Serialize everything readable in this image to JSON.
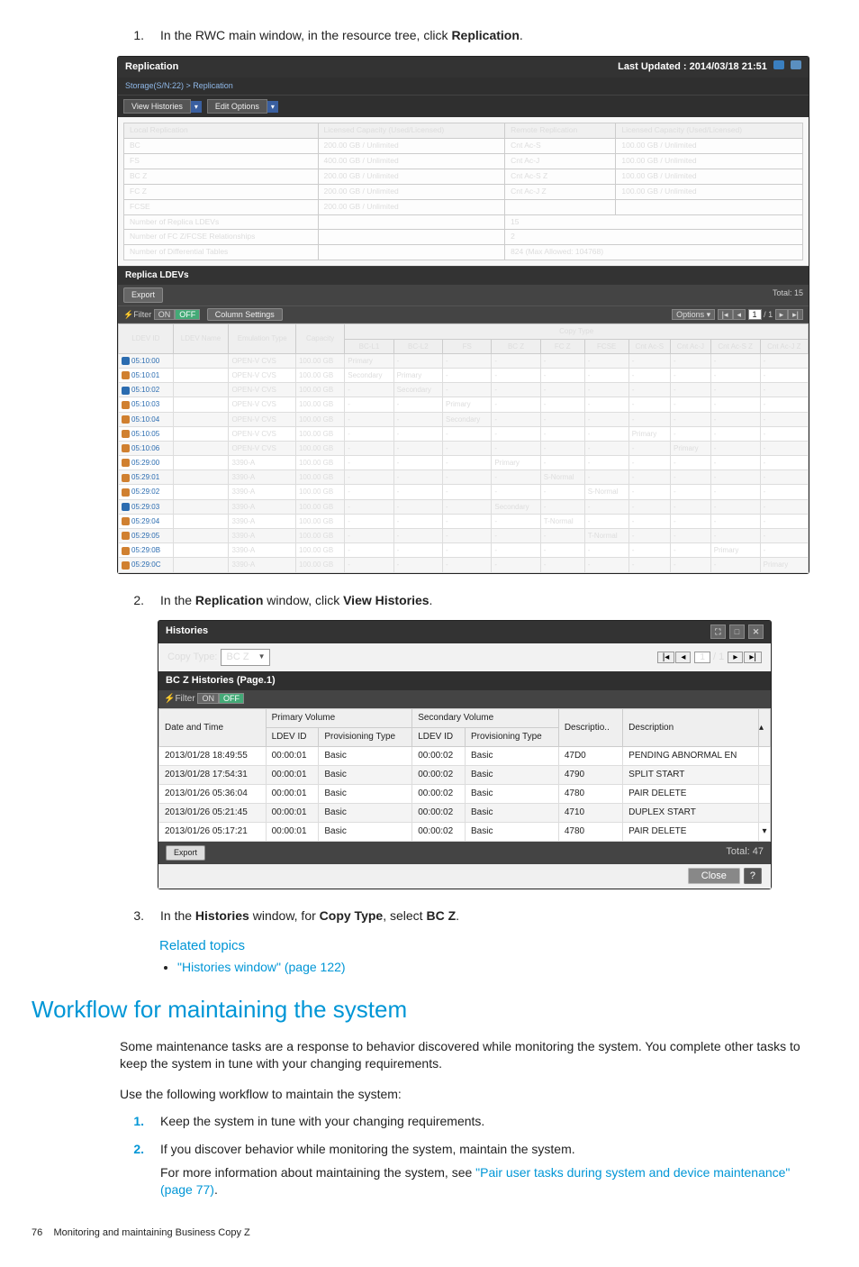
{
  "step1": {
    "num": "1.",
    "pre": "In the RWC main window, in the resource tree, click ",
    "bold": "Replication",
    "post": "."
  },
  "repl_panel": {
    "title": "Replication",
    "last_updated": "Last Updated : 2014/03/18 21:51",
    "breadcrumb": "Storage(S/N:22) > Replication",
    "dd1": "View Histories",
    "dd2": "Edit Options",
    "local_rep_hdr": "Local Replication",
    "lic_cap_hdr": "Licensed Capacity (Used/Licensed)",
    "remote_rep_hdr": "Remote Replication",
    "lic_cap_hdr2": "Licensed Capacity (Used/Licensed)",
    "local_rows": [
      {
        "n": "BC",
        "v": "200.00 GB / Unlimited"
      },
      {
        "n": "FS",
        "v": "400.00 GB / Unlimited"
      },
      {
        "n": "BC Z",
        "v": "200.00 GB / Unlimited"
      },
      {
        "n": "FC Z",
        "v": "200.00 GB / Unlimited"
      },
      {
        "n": "FCSE",
        "v": "200.00 GB / Unlimited"
      }
    ],
    "remote_rows": [
      {
        "n": "Cnt Ac-S",
        "v": "100.00 GB / Unlimited"
      },
      {
        "n": "Cnt Ac-J",
        "v": "100.00 GB / Unlimited"
      },
      {
        "n": "Cnt Ac-S Z",
        "v": "100.00 GB / Unlimited"
      },
      {
        "n": "Cnt Ac-J Z",
        "v": "100.00 GB / Unlimited"
      }
    ],
    "num_replica": {
      "l": "Number of Replica LDEVs",
      "v": "15"
    },
    "num_fcz": {
      "l": "Number of FC Z/FCSE Relationships",
      "v": "2"
    },
    "num_diff": {
      "l": "Number of Differential Tables",
      "v": "824 (Max Allowed: 104768)"
    },
    "replica_tab": "Replica LDEVs",
    "export": "Export",
    "total": "Total: 15",
    "filter": "⚡Filter",
    "on": "ON",
    "off": "OFF",
    "colset": "Column Settings",
    "options_lbl": "Options ▾",
    "pg": "1",
    "pgof": "/ 1",
    "copy_type_grp": "Copy Type",
    "cols": [
      "LDEV ID",
      "LDEV Name",
      "Emulation Type",
      "Capacity",
      "BC-L1",
      "BC-L2",
      "FS",
      "BC Z",
      "FC Z",
      "FCSE",
      "Cnt Ac-S",
      "Cnt Ac-J",
      "Cnt Ac-S Z",
      "Cnt Ac-J Z"
    ],
    "rows": [
      {
        "id": "05:10:00",
        "ic": "b",
        "emu": "OPEN-V CVS",
        "cap": "100.00 GB",
        "ct": {
          "BC-L1": "Primary"
        }
      },
      {
        "id": "05:10:01",
        "ic": "o",
        "emu": "OPEN-V CVS",
        "cap": "100.00 GB",
        "ct": {
          "BC-L1": "Secondary",
          "BC-L2": "Primary"
        }
      },
      {
        "id": "05:10:02",
        "ic": "b",
        "emu": "OPEN-V CVS",
        "cap": "100.00 GB",
        "ct": {
          "BC-L2": "Secondary"
        }
      },
      {
        "id": "05:10:03",
        "ic": "o",
        "emu": "OPEN-V CVS",
        "cap": "100.00 GB",
        "ct": {
          "FS": "Primary"
        }
      },
      {
        "id": "05:10:04",
        "ic": "o",
        "emu": "OPEN-V CVS",
        "cap": "100.00 GB",
        "ct": {
          "FS": "Secondary"
        }
      },
      {
        "id": "05:10:05",
        "ic": "o",
        "emu": "OPEN-V CVS",
        "cap": "100.00 GB",
        "ct": {
          "Cnt Ac-S": "Primary"
        }
      },
      {
        "id": "05:10:06",
        "ic": "o",
        "emu": "OPEN-V CVS",
        "cap": "100.00 GB",
        "ct": {
          "Cnt Ac-J": "Primary"
        }
      },
      {
        "id": "05:29:00",
        "ic": "o",
        "emu": "3390-A",
        "cap": "100.00 GB",
        "ct": {
          "BC Z": "Primary"
        }
      },
      {
        "id": "05:29:01",
        "ic": "o",
        "emu": "3390-A",
        "cap": "100.00 GB",
        "ct": {
          "FC Z": "S-Normal"
        }
      },
      {
        "id": "05:29:02",
        "ic": "o",
        "emu": "3390-A",
        "cap": "100.00 GB",
        "ct": {
          "FCSE": "S-Normal"
        }
      },
      {
        "id": "05:29:03",
        "ic": "b",
        "emu": "3390-A",
        "cap": "100.00 GB",
        "ct": {
          "BC Z": "Secondary"
        }
      },
      {
        "id": "05:29:04",
        "ic": "o",
        "emu": "3390-A",
        "cap": "100.00 GB",
        "ct": {
          "FC Z": "T-Normal"
        }
      },
      {
        "id": "05:29:05",
        "ic": "o",
        "emu": "3390-A",
        "cap": "100.00 GB",
        "ct": {
          "FCSE": "T-Normal"
        }
      },
      {
        "id": "05:29:0B",
        "ic": "o",
        "emu": "3390-A",
        "cap": "100.00 GB",
        "ct": {
          "Cnt Ac-S Z": "Primary"
        }
      },
      {
        "id": "05:29:0C",
        "ic": "o",
        "emu": "3390-A",
        "cap": "100.00 GB",
        "ct": {
          "Cnt Ac-J Z": "Primary"
        }
      }
    ],
    "dash": "-",
    "dot": "."
  },
  "step2": {
    "num": "2.",
    "t1": "In the ",
    "b1": "Replication",
    "t2": " window, click ",
    "b2": "View Histories",
    "post": "."
  },
  "hist": {
    "title": "Histories",
    "copy_type_lbl": "Copy Type:",
    "copy_type_val": "BC Z",
    "pg": "1",
    "pgof": "/ 1",
    "subtitle": "BC Z Histories (Page.1)",
    "filter": "⚡Filter",
    "on": "ON",
    "off": "OFF",
    "h_date": "Date and Time",
    "h_prim": "Primary Volume",
    "h_sec": "Secondary Volume",
    "h_ldev": "LDEV ID",
    "h_prov": "Provisioning Type",
    "h_descid": "Descriptio..",
    "h_desc": "Description",
    "rows": [
      {
        "dt": "2013/01/28 18:49:55",
        "p": "00:00:01",
        "pt": "Basic",
        "s": "00:00:02",
        "st": "Basic",
        "c": "47D0",
        "d": "PENDING ABNORMAL EN"
      },
      {
        "dt": "2013/01/28 17:54:31",
        "p": "00:00:01",
        "pt": "Basic",
        "s": "00:00:02",
        "st": "Basic",
        "c": "4790",
        "d": "SPLIT START"
      },
      {
        "dt": "2013/01/26 05:36:04",
        "p": "00:00:01",
        "pt": "Basic",
        "s": "00:00:02",
        "st": "Basic",
        "c": "4780",
        "d": "PAIR DELETE"
      },
      {
        "dt": "2013/01/26 05:21:45",
        "p": "00:00:01",
        "pt": "Basic",
        "s": "00:00:02",
        "st": "Basic",
        "c": "4710",
        "d": "DUPLEX START"
      },
      {
        "dt": "2013/01/26 05:17:21",
        "p": "00:00:01",
        "pt": "Basic",
        "s": "00:00:02",
        "st": "Basic",
        "c": "4780",
        "d": "PAIR DELETE"
      }
    ],
    "export": "Export",
    "total": "Total: 47",
    "close": "Close",
    "q": "?"
  },
  "step3": {
    "num": "3.",
    "t1": "In the ",
    "b1": "Histories",
    "t2": " window, for ",
    "b2": "Copy Type",
    "t3": ", select ",
    "b3": "BC Z",
    "post": "."
  },
  "related_hdr": "Related topics",
  "related_link": "\"Histories window\" (page 122)",
  "section_title": "Workflow for maintaining the system",
  "para1": "Some maintenance tasks are a response to behavior discovered while monitoring the system. You complete other tasks to keep the system in tune with your changing requirements.",
  "para2": "Use the following workflow to maintain the system:",
  "wf1": {
    "n": "1.",
    "t": "Keep the system in tune with your changing requirements."
  },
  "wf2": {
    "n": "2.",
    "t": "If you discover behavior while monitoring the system, maintain the system.",
    "more_pre": "For more information about maintaining the system, see ",
    "more_link": "\"Pair user tasks during system and device maintenance\" (page 77)",
    "more_post": "."
  },
  "footer": {
    "pg": "76",
    "txt": "Monitoring and maintaining Business Copy Z"
  }
}
